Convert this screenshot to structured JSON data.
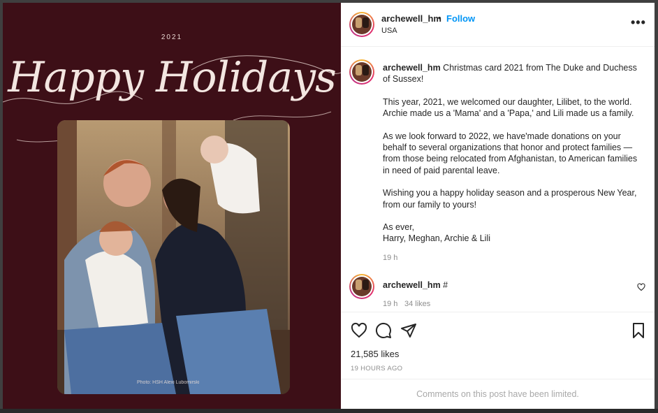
{
  "media": {
    "year": "2021",
    "title": "Happy Holidays",
    "photo_credit": "Photo: HSH Alexi Lubomirski"
  },
  "header": {
    "username": "archewell_hm",
    "separator": "•",
    "follow_label": "Follow",
    "location": "USA",
    "more_icon": "more-options-icon"
  },
  "caption": {
    "username": "archewell_hm",
    "paragraphs": [
      "Christmas card 2021 from The Duke and Duchess of Sussex!",
      "This year, 2021, we welcomed our daughter, Lilibet, to the world. Archie made us a 'Mama' and a 'Papa,' and Lili made us a family.",
      "As we look forward to 2022, we have'made donations on your behalf to several organizations that honor and protect families — from those being relocated from Afghanistan, to American families in need of paid parental leave.",
      "Wishing you a happy holiday season and a prosperous New Year, from our family to yours!",
      "As ever,\nHarry, Meghan, Archie & Lili"
    ],
    "timestamp": "19 h"
  },
  "comment": {
    "username": "archewell_hm",
    "text": "#",
    "timestamp": "19 h",
    "likes": "34 likes"
  },
  "actions": {
    "like_icon": "heart-icon",
    "comment_icon": "comment-icon",
    "share_icon": "share-icon",
    "save_icon": "bookmark-icon",
    "likes_count": "21,585 likes",
    "time_ago": "19 HOURS AGO",
    "comments_limited": "Comments on this post have been limited."
  },
  "colors": {
    "card_background": "#3d0f17",
    "follow_blue": "#0095f6",
    "muted_text": "#8e8e8e"
  }
}
